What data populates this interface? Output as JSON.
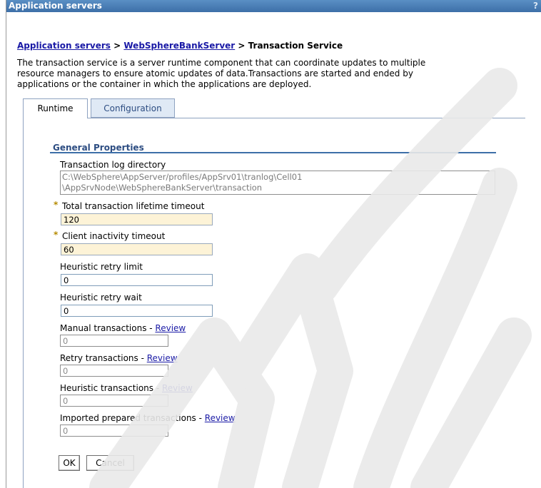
{
  "window": {
    "title": "Application servers",
    "help_label": "?"
  },
  "breadcrumb": {
    "item1": "Application servers",
    "sep1": " > ",
    "item2": "WebSphereBankServer",
    "sep2": " > ",
    "current": "Transaction Service"
  },
  "description": {
    "line1": "The transaction service is a server runtime component that can coordinate updates to multiple",
    "line2": "resource managers to ensure atomic updates of data.Transactions are started and ended by",
    "line3": "applications or the container in which the applications are deployed."
  },
  "tabs": {
    "runtime": "Runtime",
    "configuration": "Configuration"
  },
  "general_properties": {
    "title": "General Properties",
    "log_dir_label": "Transaction log directory",
    "log_dir_line1": "C:\\WebSphere\\AppServer/profiles/AppSrv01\\tranlog\\Cell01",
    "log_dir_line2": "\\AppSrvNode\\WebSphereBankServer\\transaction",
    "required_marker": "*",
    "total_timeout_label": "Total transaction lifetime timeout",
    "total_timeout_value": "120",
    "client_timeout_label": "Client inactivity timeout",
    "client_timeout_value": "60",
    "retry_limit_label": "Heuristic retry limit",
    "retry_limit_value": "0",
    "retry_wait_label": "Heuristic retry wait",
    "retry_wait_value": "0",
    "manual_label": "Manual transactions - ",
    "manual_value": "0",
    "retry_tx_label": "Retry transactions - ",
    "retry_tx_value": "0",
    "heuristic_tx_label": "Heuristic transactions - ",
    "heuristic_tx_value": "0",
    "imported_label": "Imported prepared transactions - ",
    "imported_value": "0",
    "review_link": "Review"
  },
  "buttons": {
    "ok": "OK",
    "cancel": "Cancel"
  },
  "colors": {
    "titlebar": "#3d6fa8",
    "link": "#1a1aa6",
    "required_field_bg": "#fdf3d7"
  }
}
